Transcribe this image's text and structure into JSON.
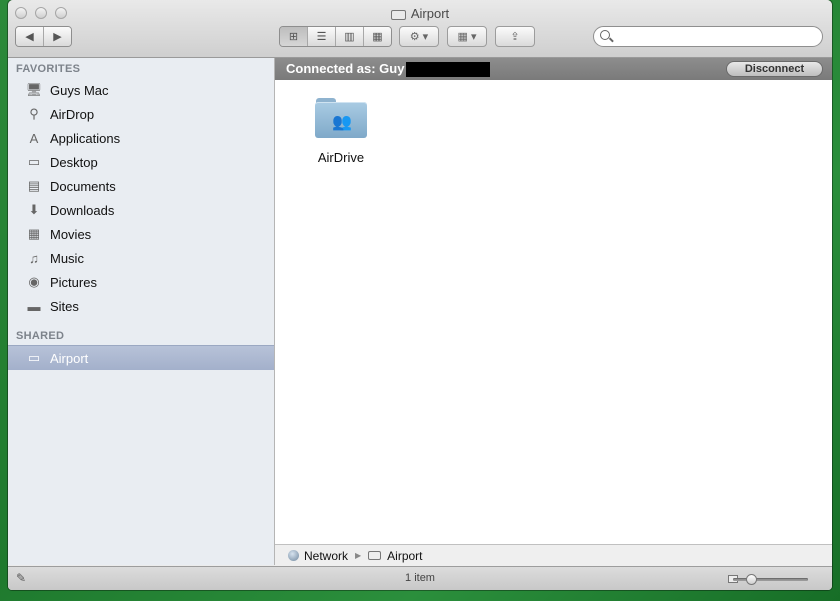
{
  "window": {
    "title": "Airport"
  },
  "toolbar": {
    "back_icon": "◀",
    "forward_icon": "▶",
    "view_icons": [
      "⊞",
      "☰",
      "▥",
      "▦"
    ],
    "action_icon": "⚙ ▾",
    "arrange_icon": "▦ ▾",
    "share_icon": "⇪",
    "search_placeholder": ""
  },
  "sidebar": {
    "favorites_header": "FAVORITES",
    "favorites": [
      {
        "label": "Guys Mac",
        "icon": "computer-icon",
        "glyph": "🖥"
      },
      {
        "label": "AirDrop",
        "icon": "airdrop-icon",
        "glyph": "⚲"
      },
      {
        "label": "Applications",
        "icon": "applications-icon",
        "glyph": "A"
      },
      {
        "label": "Desktop",
        "icon": "desktop-icon",
        "glyph": "▭"
      },
      {
        "label": "Documents",
        "icon": "documents-icon",
        "glyph": "▤"
      },
      {
        "label": "Downloads",
        "icon": "downloads-icon",
        "glyph": "⬇"
      },
      {
        "label": "Movies",
        "icon": "movies-icon",
        "glyph": "▦"
      },
      {
        "label": "Music",
        "icon": "music-icon",
        "glyph": "♫"
      },
      {
        "label": "Pictures",
        "icon": "pictures-icon",
        "glyph": "◉"
      },
      {
        "label": "Sites",
        "icon": "folder-icon",
        "glyph": "▬"
      }
    ],
    "shared_header": "SHARED",
    "shared": [
      {
        "label": "Airport",
        "icon": "airport-disk-icon",
        "glyph": "▭"
      }
    ]
  },
  "main": {
    "connected_label": "Connected as: Guy",
    "disconnect_label": "Disconnect",
    "items": [
      {
        "name": "AirDrive",
        "icon": "shared-folder-icon"
      }
    ]
  },
  "pathbar": {
    "crumbs": [
      "Network",
      "Airport"
    ]
  },
  "statusbar": {
    "item_count": "1 item",
    "icon_size_level": 0.2
  },
  "colors": {
    "selection": "#a9b5cf",
    "connected_bar": "#848484",
    "desktop_bg": "#2c8a3a"
  }
}
